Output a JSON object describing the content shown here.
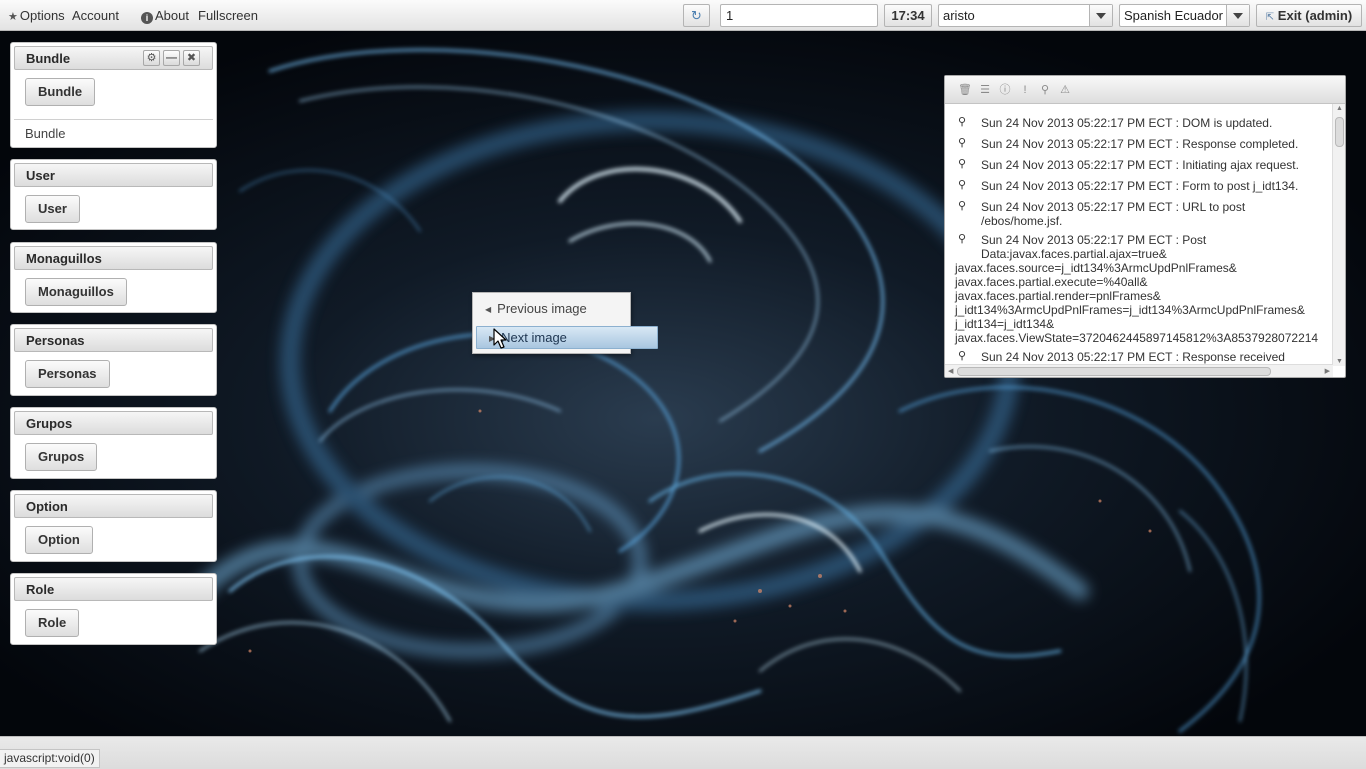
{
  "topbar": {
    "options_label": "Options",
    "account_label": "Account",
    "about_label": "About",
    "fullscreen_label": "Fullscreen",
    "page_field_value": "1",
    "clock": "17:34",
    "theme_value": "aristo",
    "locale_value": "Spanish Ecuador",
    "exit_label": "Exit (admin)"
  },
  "panels": [
    {
      "title": "Bundle",
      "button": "Bundle",
      "content": "Bundle"
    },
    {
      "title": "User",
      "button": "User"
    },
    {
      "title": "Monaguillos",
      "button": "Monaguillos"
    },
    {
      "title": "Personas",
      "button": "Personas"
    },
    {
      "title": "Grupos",
      "button": "Grupos"
    },
    {
      "title": "Option",
      "button": "Option"
    },
    {
      "title": "Role",
      "button": "Role"
    }
  ],
  "context_menu": {
    "previous": "Previous image",
    "next": "Next image"
  },
  "log": {
    "entries": [
      "Sun 24 Nov 2013 05:22:17 PM ECT : DOM is updated.",
      "Sun 24 Nov 2013 05:22:17 PM ECT : Response completed.",
      "Sun 24 Nov 2013 05:22:17 PM ECT : Initiating ajax request.",
      "Sun 24 Nov 2013 05:22:17 PM ECT : Form to post j_idt134.",
      "Sun 24 Nov 2013 05:22:17 PM ECT : URL to post",
      "/ebos/home.jsf.",
      "Sun 24 Nov 2013 05:22:17 PM ECT : Post",
      "Data:javax.faces.partial.ajax=true&",
      "javax.faces.source=j_idt134%3ArmcUpdPnlFrames&",
      "javax.faces.partial.execute=%40all&",
      "javax.faces.partial.render=pnlFrames&",
      "j_idt134%3ArmcUpdPnlFrames=j_idt134%3ArmcUpdPnlFrames&",
      "j_idt134=j_idt134&",
      "javax.faces.ViewState=3720462445897145812%3A8537928072214",
      "Sun 24 Nov 2013 05:22:17 PM ECT : Response received"
    ]
  },
  "status": {
    "text": "javascript:void(0)"
  }
}
